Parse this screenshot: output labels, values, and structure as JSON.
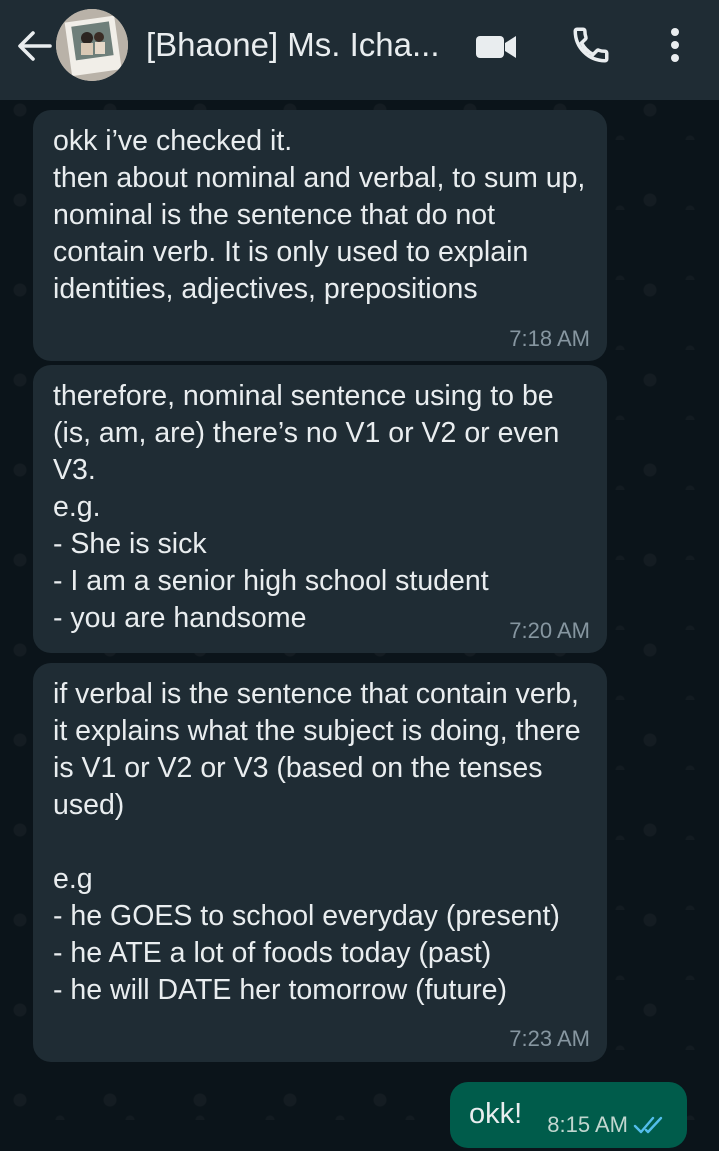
{
  "header": {
    "back_icon": "arrow-left-icon",
    "contact_name": "[Bhaone] Ms. Icha...",
    "video_icon": "video-camera-icon",
    "call_icon": "phone-icon",
    "more_icon": "more-vertical-icon",
    "colors": {
      "bar": "#1f2c34",
      "icon": "#e9edef"
    }
  },
  "messages": [
    {
      "direction": "incoming",
      "text": "okk i’ve checked it.\nthen about nominal and verbal, to sum up, nominal is the sentence that do not contain verb. It is only used to explain identities, adjectives, prepositions",
      "time": "7:18 AM"
    },
    {
      "direction": "incoming",
      "text": "therefore, nominal sentence using to be (is, am, are) there’s no V1 or V2 or even V3.\ne.g.\n- She is sick\n- I am a senior high school student\n- you are handsome",
      "time": "7:20 AM"
    },
    {
      "direction": "incoming",
      "text": "if verbal is the sentence that contain verb, it explains what the subject is doing, there is V1 or V2 or V3 (based on the tenses used)\n\ne.g\n- he GOES to school everyday (present)\n- he ATE a lot of foods today (past)\n- he will DATE her tomorrow (future)",
      "time": "7:23 AM"
    },
    {
      "direction": "outgoing",
      "text": "okk!",
      "time": "8:15 AM",
      "status_icon": "double-check-read-icon"
    }
  ],
  "colors": {
    "background": "#0b141a",
    "incoming_bubble": "#1f2c34",
    "outgoing_bubble": "#005c4b",
    "timestamp": "#8696a0",
    "read_ticks": "#53bdeb"
  }
}
